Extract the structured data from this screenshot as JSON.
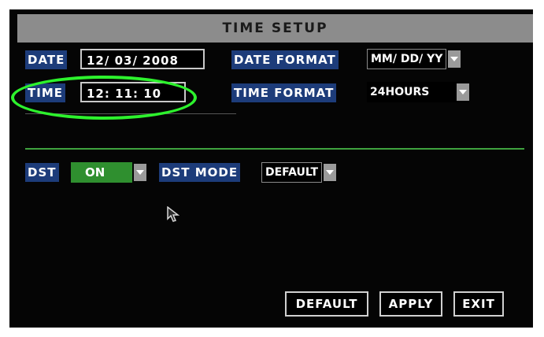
{
  "title": "TIME SETUP",
  "date": {
    "label": "DATE",
    "value": "12/ 03/ 2008"
  },
  "time": {
    "label": "TIME",
    "value": "12: 11: 10"
  },
  "date_format": {
    "label": "DATE FORMAT",
    "value": "MM/ DD/ YY"
  },
  "time_format": {
    "label": "TIME FORMAT",
    "value": "24HOURS"
  },
  "dst": {
    "label": "DST",
    "value": "ON"
  },
  "dst_mode": {
    "label": "DST MODE",
    "value": "DEFAULT"
  },
  "buttons": {
    "default": "DEFAULT",
    "apply": "APPLY",
    "exit": "EXIT"
  },
  "colors": {
    "title_bar": "#8c8c8c",
    "label_bg": "#1d3c7a",
    "divider": "#3fa33f",
    "dst_on_bg": "#2f8f2f",
    "highlight_ring": "#2df22d"
  },
  "icons": {
    "dropdown": "chevron-down-icon",
    "cursor": "mouse-pointer-icon"
  }
}
